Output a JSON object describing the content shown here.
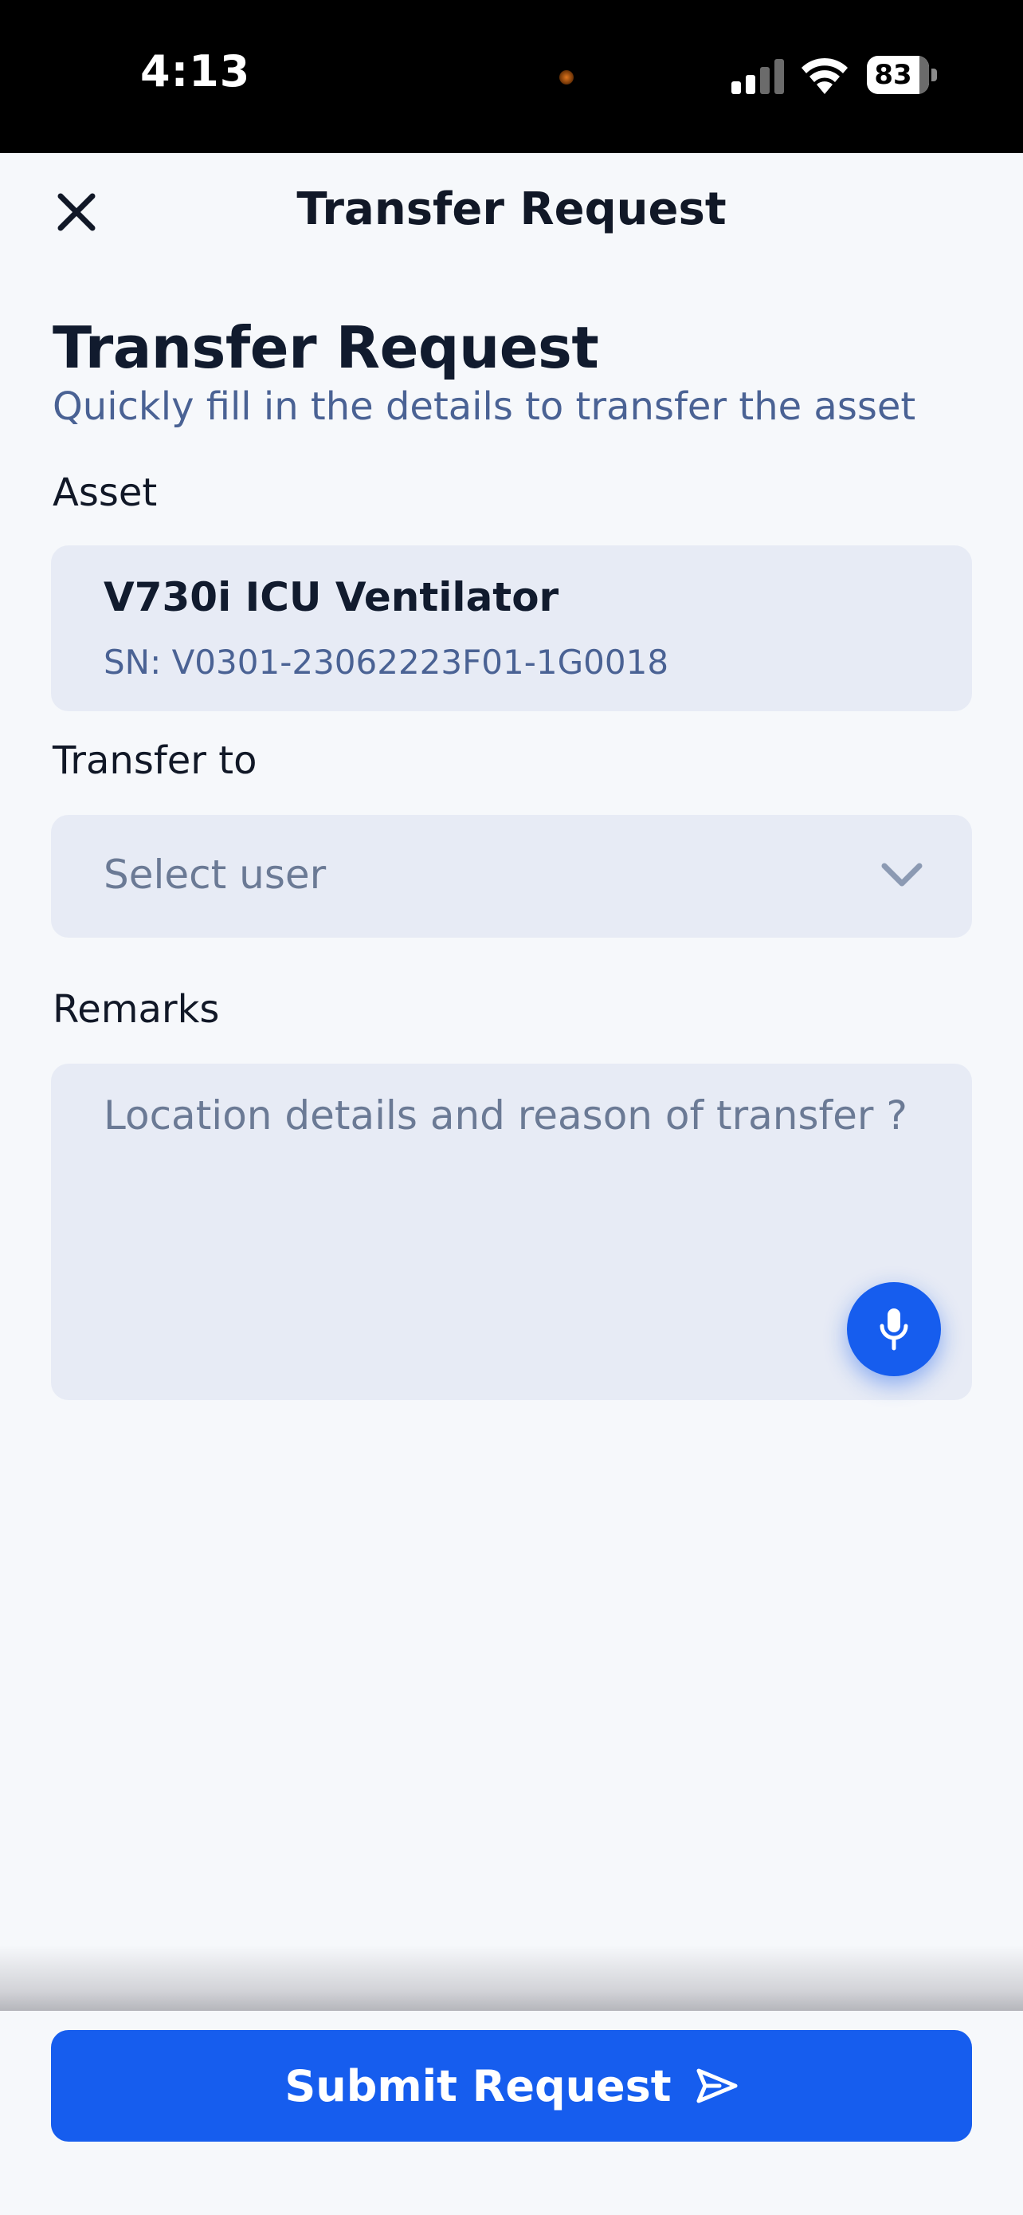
{
  "status_bar": {
    "time": "4:13",
    "battery": "83"
  },
  "nav": {
    "title": "Transfer Request",
    "close_icon": "close-icon"
  },
  "header": {
    "title": "Transfer Request",
    "subtitle": "Quickly fill in the details to transfer the asset"
  },
  "asset": {
    "label": "Asset",
    "name": "V730i ICU Ventilator",
    "serial": "SN: V0301-23062223F01-1G0018"
  },
  "transfer_to": {
    "label": "Transfer to",
    "placeholder": "Select user",
    "icon": "chevron-down-icon"
  },
  "remarks": {
    "label": "Remarks",
    "placeholder": "Location details and reason of transfer ?",
    "value": "",
    "icon": "microphone-icon"
  },
  "submit": {
    "label": "Submit Request",
    "icon": "send-icon"
  },
  "colors": {
    "primary": "#165DEE",
    "background": "#F6F8FB",
    "field_background": "#E7EBF5",
    "heading": "#111B2E",
    "subtitle": "#4A6294",
    "placeholder": "#6B7A95"
  }
}
